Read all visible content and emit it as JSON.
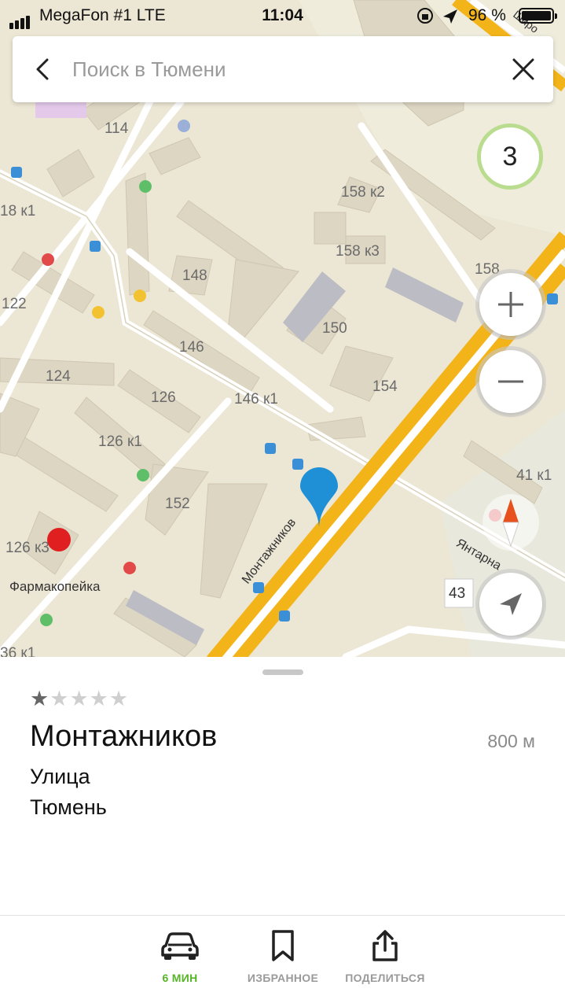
{
  "status_bar": {
    "carrier": "MegaFon #1  LTE",
    "time": "11:04",
    "battery": "96 %"
  },
  "search": {
    "placeholder": "Поиск в Тюмени",
    "value": ""
  },
  "traffic": {
    "level": "3",
    "color": "#b9dc8e"
  },
  "map": {
    "labels": {
      "b114": "114",
      "b158k2": "158 к2",
      "b158k3": "158 к3",
      "b158": "158",
      "b18k1": "18 к1",
      "b148": "148",
      "b122": "122",
      "b150": "150",
      "b146": "146",
      "b124": "124",
      "b126": "126",
      "b146k1": "146 к1",
      "b154": "154",
      "b126k1": "126 к1",
      "b152": "152",
      "b41k1": "41 к1",
      "b126k3": "126 к3",
      "b43": "43",
      "b36k1": "36 к1"
    },
    "streets": {
      "montazhnikov": "Монтажников",
      "yantarnaya": "Янтарна",
      "shirotnaya": "Широ"
    },
    "poi": {
      "pharmacy": "Фармакопейка"
    },
    "colors": {
      "road_major": "#f3b41a",
      "road_minor": "#ffffff",
      "background": "#ece6d4",
      "building": "#ddd6c3",
      "pin": "#1f8fd6"
    }
  },
  "card": {
    "rating": {
      "value": 1,
      "max": 5
    },
    "title": "Монтажников",
    "distance": "800 м",
    "type": "Улица",
    "city": "Тюмень"
  },
  "actions": {
    "route": "6 МИН",
    "favorites": "ИЗБРАННОЕ",
    "share": "ПОДЕЛИТЬСЯ"
  },
  "accent_color": "#56b427"
}
